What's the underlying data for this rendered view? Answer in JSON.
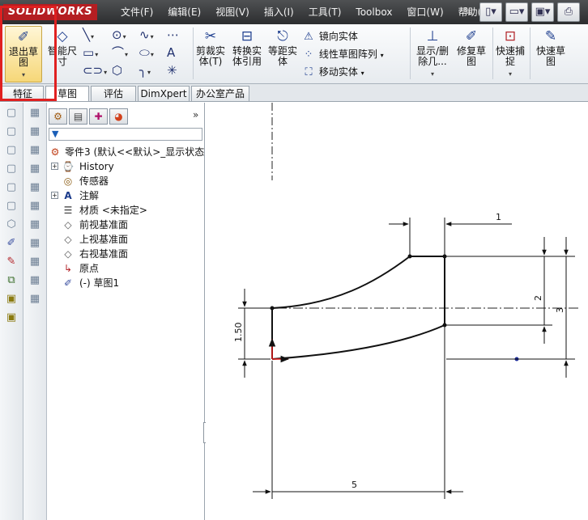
{
  "app": {
    "brand": "SOLIDWORKS",
    "menu": [
      "文件(F)",
      "编辑(E)",
      "视图(V)",
      "插入(I)",
      "工具(T)",
      "Toolbox",
      "窗口(W)",
      "帮助(H)"
    ]
  },
  "ribbon": {
    "exit_sketch": "退出草图",
    "smart_dim": "智能尺寸",
    "trim": "剪裁实体(T)",
    "convert": "转换实体引用",
    "offset": "等距实体",
    "mirror": "镜向实体",
    "linear_pattern": "线性草图阵列",
    "move": "移动实体",
    "show_delete": "显示/删除几...",
    "repair": "修复草图",
    "quick_snap": "快速捕捉",
    "rapid_sketch": "快速草图"
  },
  "tabs": [
    "特征",
    "草图",
    "评估",
    "DimXpert",
    "办公室产品"
  ],
  "tree": {
    "part": "零件3 (默认<<默认>_显示状态",
    "items": [
      "History",
      "传感器",
      "注解",
      "材质 <未指定>",
      "前视基准面",
      "上视基准面",
      "右视基准面",
      "原点",
      "(-) 草图1"
    ]
  },
  "dimensions": {
    "top_width": "1",
    "right_height": "2",
    "right_total": "3",
    "left_height": "1.50",
    "bottom_length": "5"
  }
}
